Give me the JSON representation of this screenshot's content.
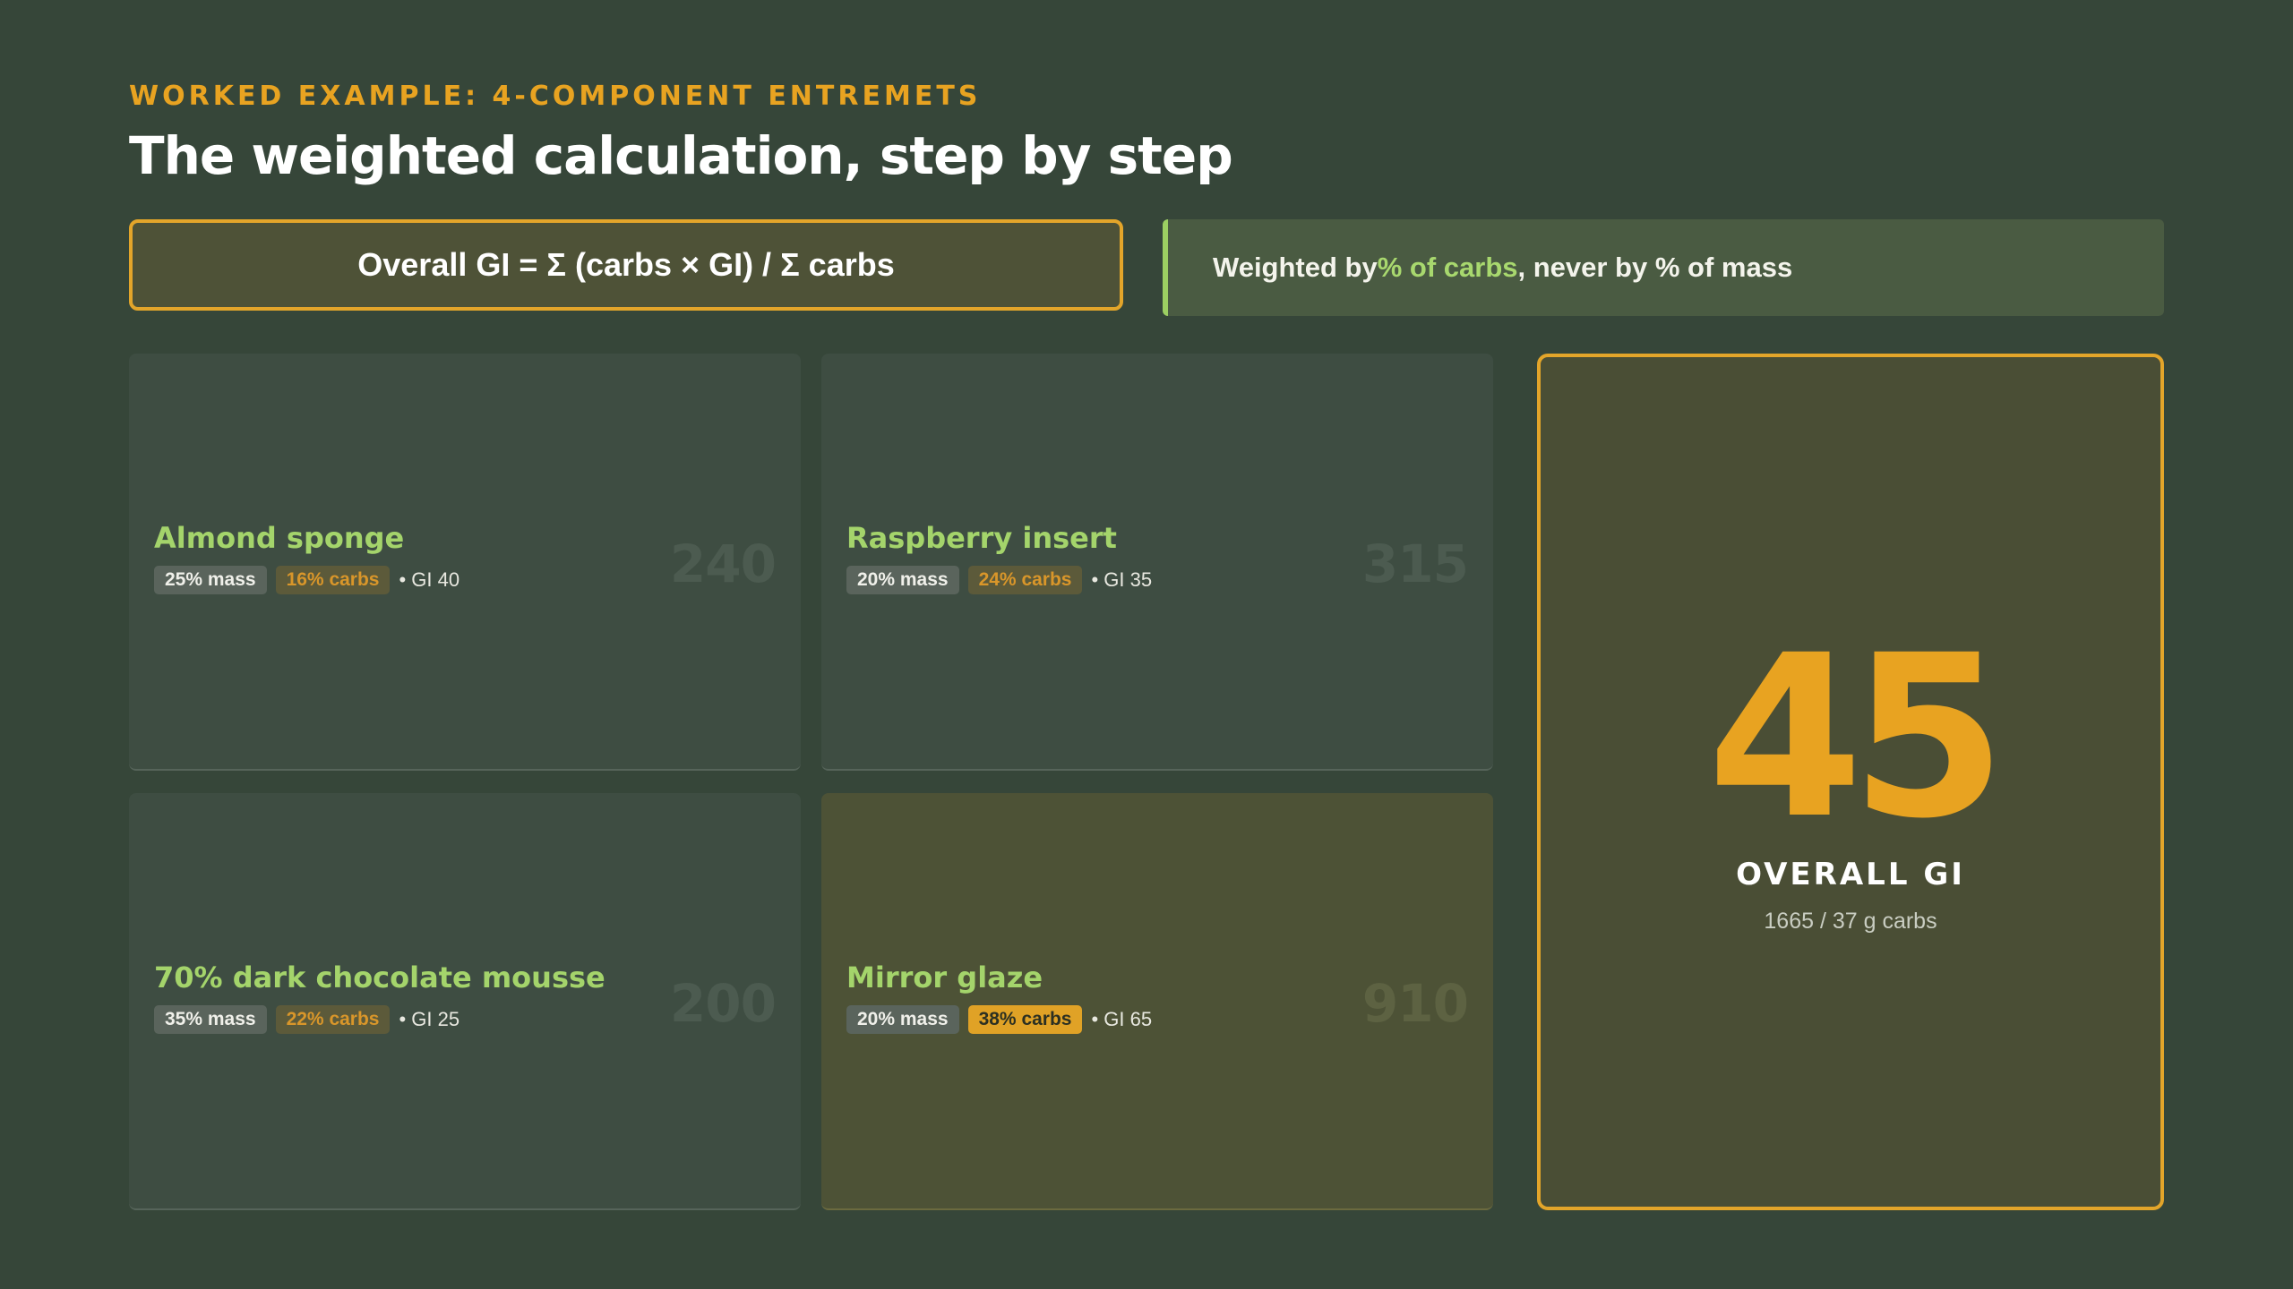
{
  "header": {
    "eyebrow": "WORKED EXAMPLE: 4-COMPONENT ENTREMETS",
    "title": "The weighted calculation, step by step"
  },
  "formula": "Overall GI = Σ (carbs × GI) / Σ carbs",
  "note": {
    "prefix": "Weighted by",
    "highlight": "% of carbs",
    "suffix": ", never by % of mass"
  },
  "components": [
    {
      "name": "Almond sponge",
      "mass": "25% mass",
      "carbs": "16% carbs",
      "gi": "• GI 40",
      "product": "240"
    },
    {
      "name": "Raspberry insert",
      "mass": "20% mass",
      "carbs": "24% carbs",
      "gi": "• GI 35",
      "product": "315"
    },
    {
      "name": "70% dark chocolate mousse",
      "mass": "35% mass",
      "carbs": "22% carbs",
      "gi": "• GI 25",
      "product": "200"
    },
    {
      "name": "Mirror glaze",
      "mass": "20% mass",
      "carbs": "38% carbs",
      "gi": "• GI 65",
      "product": "910"
    }
  ],
  "result": {
    "value": "45",
    "label": "OVERALL GI",
    "detail": "1665 / 37 g carbs"
  },
  "colors": {
    "background": "#364639",
    "accent": "#e8a321",
    "highlight_green": "#a4d46b"
  }
}
